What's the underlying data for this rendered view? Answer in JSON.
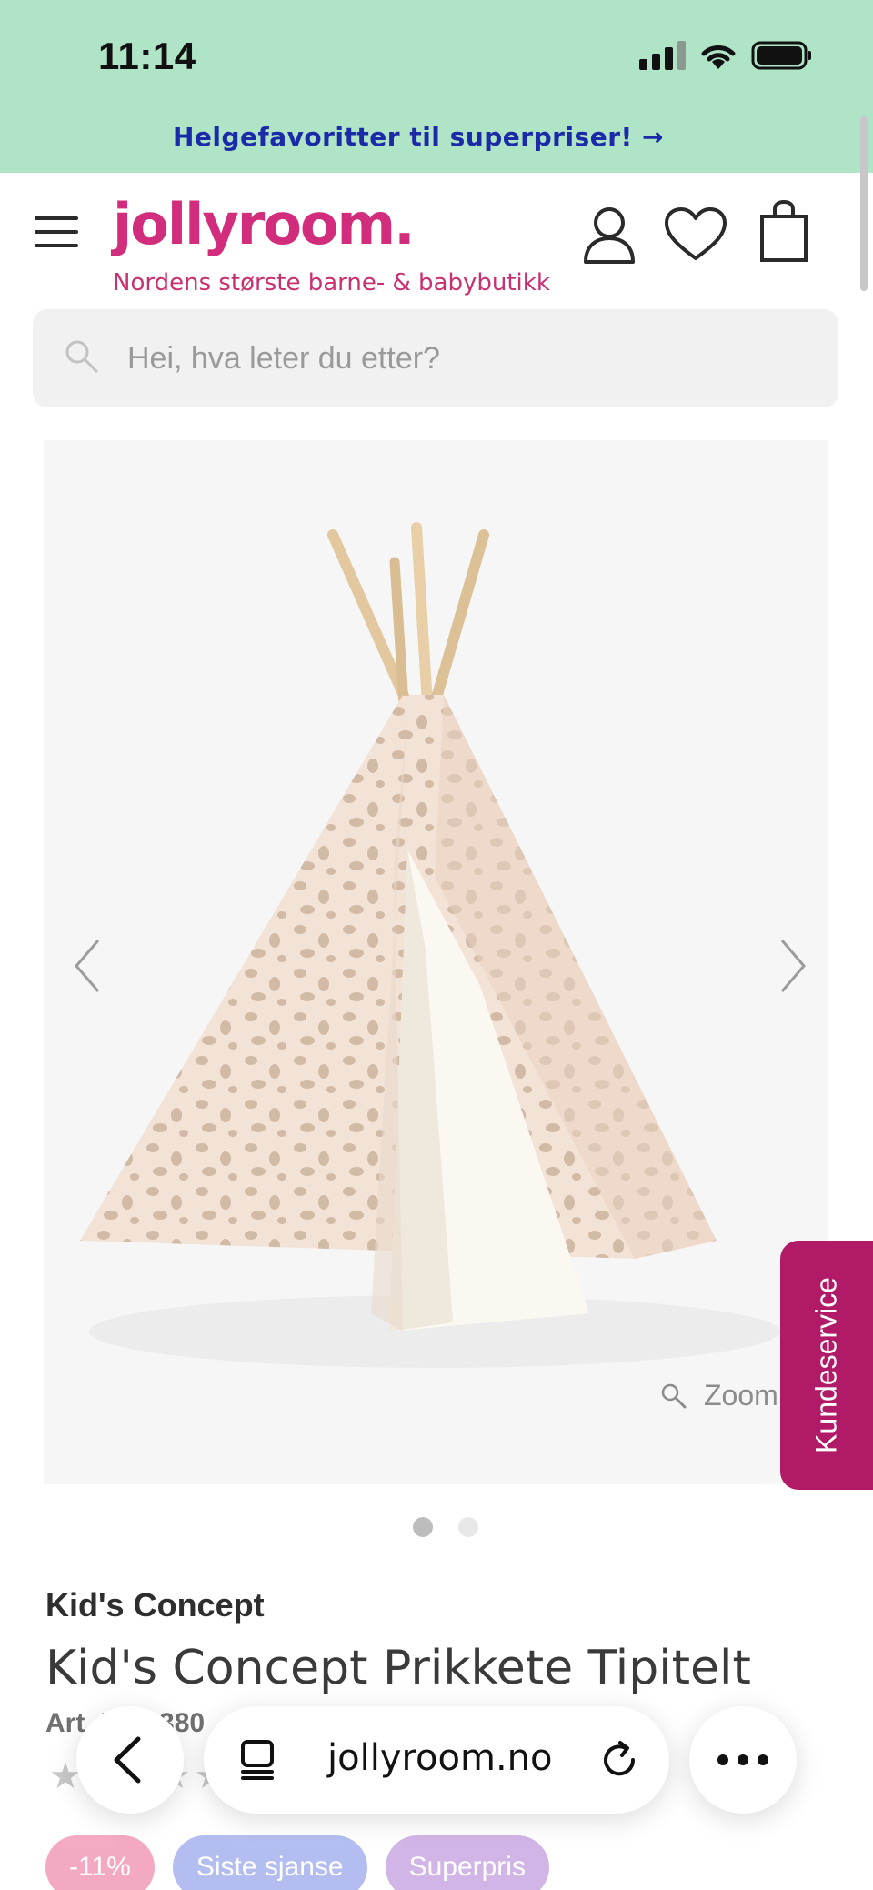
{
  "status_bar": {
    "time": "11:14",
    "icons": [
      "signal-icon",
      "wifi-icon",
      "battery-icon"
    ]
  },
  "promo": {
    "text": "Helgefavoritter til superpriser! →"
  },
  "header": {
    "logo": "jollyroom.",
    "tagline": "Nordens største barne- & babybutikk",
    "icons": [
      "menu-icon",
      "account-icon",
      "wishlist-icon",
      "cart-icon"
    ]
  },
  "search": {
    "placeholder": "Hei, hva leter du etter?"
  },
  "gallery": {
    "zoom_label": "Zoom",
    "slide_count": 2,
    "active_slide": 1
  },
  "kundeservice": {
    "label": "Kundeservice"
  },
  "product": {
    "brand": "Kid's Concept",
    "title": "Kid's Concept Prikkete Tipitelt",
    "article_no": "Art. ID: 6380",
    "rating_stars": "★★★★★"
  },
  "badges": [
    {
      "label": "-11%",
      "color": "#e8437c"
    },
    {
      "label": "Siste sjanse",
      "color": "#5a6fe0"
    },
    {
      "label": "Superpris",
      "color": "#9b5cc9"
    }
  ],
  "browser": {
    "url": "jollyroom.no"
  },
  "colors": {
    "brand": "#d12d7c",
    "promo_band": "#b0e4c6",
    "kundeservice": "#b01a66"
  }
}
